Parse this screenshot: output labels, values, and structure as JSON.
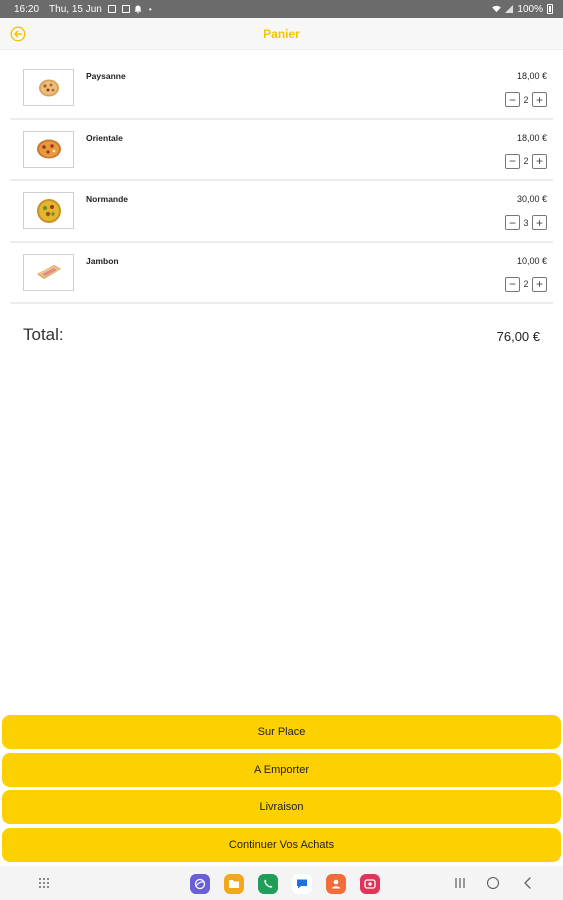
{
  "status_bar": {
    "time": "16:20",
    "date": "Thu, 15 Jun",
    "battery": "100%"
  },
  "header": {
    "title": "Panier",
    "accent_color": "#f5c400"
  },
  "cart": {
    "items": [
      {
        "name": "Paysanne",
        "price": "18,00 €",
        "quantity": "2",
        "minus": "−",
        "plus": "+"
      },
      {
        "name": "Orientale",
        "price": "18,00 €",
        "quantity": "2",
        "minus": "−",
        "plus": "+"
      },
      {
        "name": "Normande",
        "price": "30,00 €",
        "quantity": "3",
        "minus": "−",
        "plus": "+"
      },
      {
        "name": "Jambon",
        "price": "10,00 €",
        "quantity": "2",
        "minus": "−",
        "plus": "+"
      }
    ]
  },
  "total": {
    "label": "Total:",
    "value": "76,00 €"
  },
  "actions": {
    "sur_place": "Sur Place",
    "a_emporter": "A Emporter",
    "livraison": "Livraison",
    "continuer": "Continuer Vos Achats",
    "button_color": "#fdd000"
  },
  "nav": {
    "dock_apps": [
      "internet-app",
      "files-app",
      "phone-app",
      "messages-app",
      "contacts-app",
      "screen-recorder-app"
    ]
  }
}
